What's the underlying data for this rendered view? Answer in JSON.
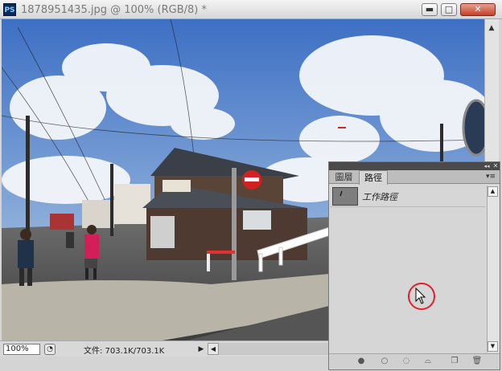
{
  "window": {
    "app_icon": "PS",
    "title": "1878951435.jpg @ 100% (RGB/8) *",
    "minimize_glyph": "▬",
    "maximize_glyph": "□",
    "close_glyph": "✕"
  },
  "status": {
    "zoom": "100%",
    "doc_info": "文件: 703.1K/703.1K",
    "arrow_glyph": "▶",
    "scroll_left_glyph": "◀"
  },
  "panel": {
    "tabs": [
      {
        "label": "圖層",
        "active": false
      },
      {
        "label": "路徑",
        "active": true
      }
    ],
    "collapse_glyph": "◂◂",
    "close_glyph": "✕",
    "menu_glyph": "▾≡",
    "paths": [
      {
        "name": "工作路徑"
      }
    ],
    "footer_icons": [
      "fill-path-icon",
      "stroke-path-icon",
      "load-selection-icon",
      "make-work-path-icon",
      "new-path-icon",
      "delete-path-icon"
    ]
  },
  "colors": {
    "accent_red": "#e0202a",
    "panel_header": "#4a4a4a",
    "sky": "#4f7fcc"
  }
}
